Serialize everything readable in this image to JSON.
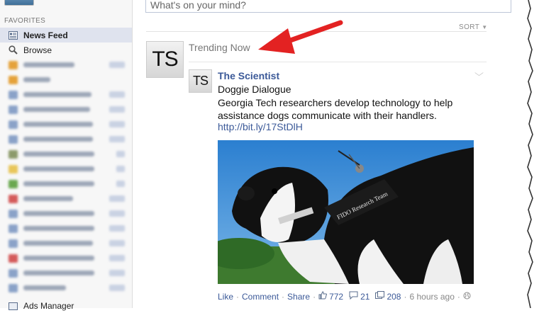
{
  "sidebar": {
    "favorites_header": "FAVORITES",
    "items": [
      {
        "label": "News Feed",
        "icon": "news-feed-icon",
        "active": true
      },
      {
        "label": "Browse",
        "icon": "search-icon",
        "active": false
      }
    ],
    "bottom_item": {
      "label": "Ads Manager",
      "icon": "ads-manager-icon"
    }
  },
  "composer": {
    "placeholder": "What's on your mind?"
  },
  "feed": {
    "sort_label": "SORT",
    "trending_label": "Trending Now",
    "page_logo_text": "TS"
  },
  "post": {
    "author": "The Scientist",
    "title": "Doggie Dialogue",
    "body": "Georgia Tech researchers develop technology to help assistance dogs communicate with their handlers.",
    "link": "http://bit.ly/17StDlH",
    "photo_vest_text": "FIDO Research Team",
    "actions": {
      "like": "Like",
      "comment": "Comment",
      "share": "Share",
      "likes_count": "772",
      "comments_count": "21",
      "shares_count": "208",
      "time": "6 hours ago"
    }
  },
  "colors": {
    "link_blue": "#3b5998",
    "arrow_red": "#e32222",
    "sidebar_bg": "#f7f7f7"
  }
}
